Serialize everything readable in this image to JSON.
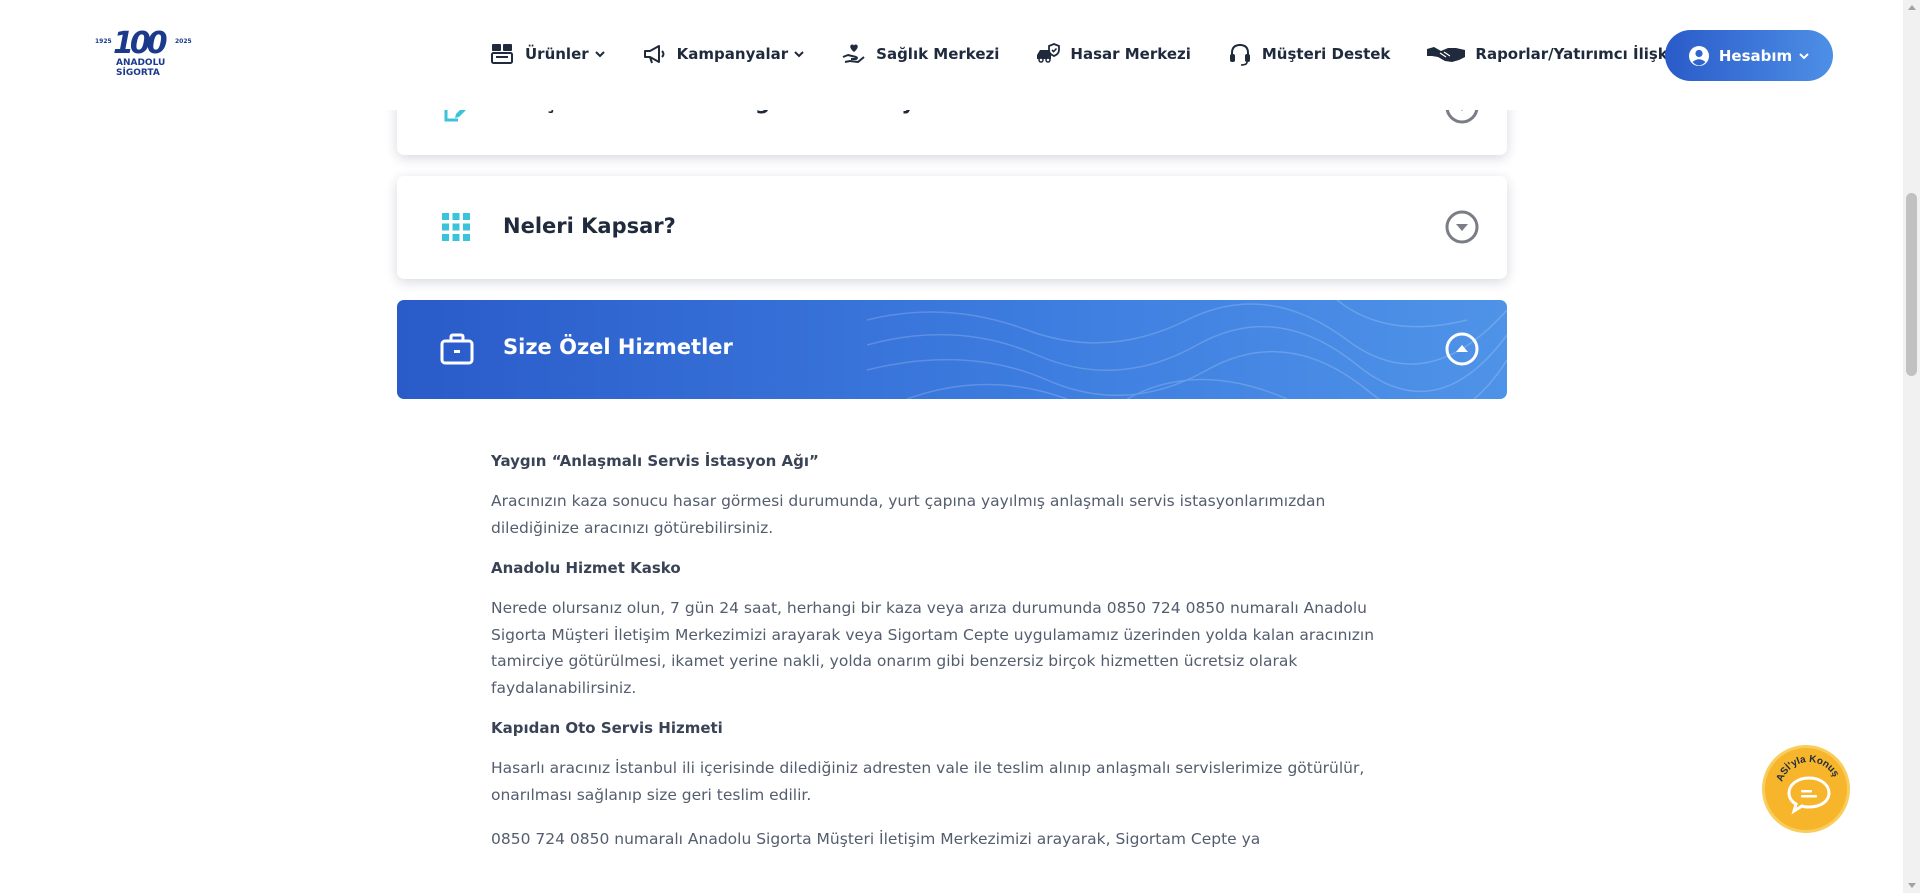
{
  "brand": {
    "name_line1": "ANADOLU",
    "name_line2": "SİGORTA",
    "year_start": "1925",
    "year_end": "2025",
    "anniversary": "100",
    "color": "#1b3a8c"
  },
  "nav": {
    "items": [
      {
        "label": "Ürünler",
        "icon": "products-icon",
        "dropdown": true
      },
      {
        "label": "Kampanyalar",
        "icon": "megaphone-icon",
        "dropdown": true
      },
      {
        "label": "Sağlık Merkezi",
        "icon": "health-hand-icon",
        "dropdown": false
      },
      {
        "label": "Hasar Merkezi",
        "icon": "car-shield-icon",
        "dropdown": false
      },
      {
        "label": "Müşteri Destek",
        "icon": "headset-icon",
        "dropdown": false
      },
      {
        "label": "Raporlar/Yatırımcı İlişkileri",
        "icon": "handshake-icon",
        "dropdown": false
      }
    ],
    "account_label": "Hesabım"
  },
  "accordion": {
    "partial_title": "Bütçe Dostu Kasko Sigortası Detayları",
    "covers_title": "Neleri Kapsar?",
    "active_title": "Size Özel Hizmetler"
  },
  "content": {
    "s1_heading": "Yaygın “Anlaşmalı Servis İstasyon Ağı”",
    "s1_text": "Aracınızın kaza sonucu hasar görmesi durumunda, yurt çapına yayılmış anlaşmalı servis istasyonlarımızdan dilediğinize aracınızı götürebilirsiniz.",
    "s2_heading": "Anadolu Hizmet Kasko",
    "s2_text": "Nerede olursanız olun, 7 gün 24 saat, herhangi bir kaza veya arıza durumunda 0850 724 0850 numaralı Anadolu Sigorta Müşteri İletişim Merkezimizi arayarak veya Sigortam Cepte uygulamamız üzerinden yolda kalan aracınızın tamirciye götürülmesi, ikamet yerine nakli, yolda onarım gibi benzersiz birçok hizmetten ücretsiz olarak faydalanabilirsiniz.",
    "s3_heading": "Kapıdan Oto Servis Hizmeti",
    "s3_text": "Hasarlı aracınız İstanbul ili içerisinde dilediğiniz adresten vale ile teslim alınıp anlaşmalı servislerimize götürülür, onarılması sağlanıp size geri teslim edilir.",
    "s4_text": "0850 724 0850 numaralı Anadolu Sigorta Müşteri İletişim Merkezimizi arayarak, Sigortam Cepte ya"
  },
  "chat": {
    "label": "ASİ'yla Konuş"
  },
  "colors": {
    "accent_start": "#2a5bc9",
    "accent_end": "#4f93e8",
    "icon_teal": "#3cc3dc",
    "chat_yellow": "#f7b52c"
  }
}
